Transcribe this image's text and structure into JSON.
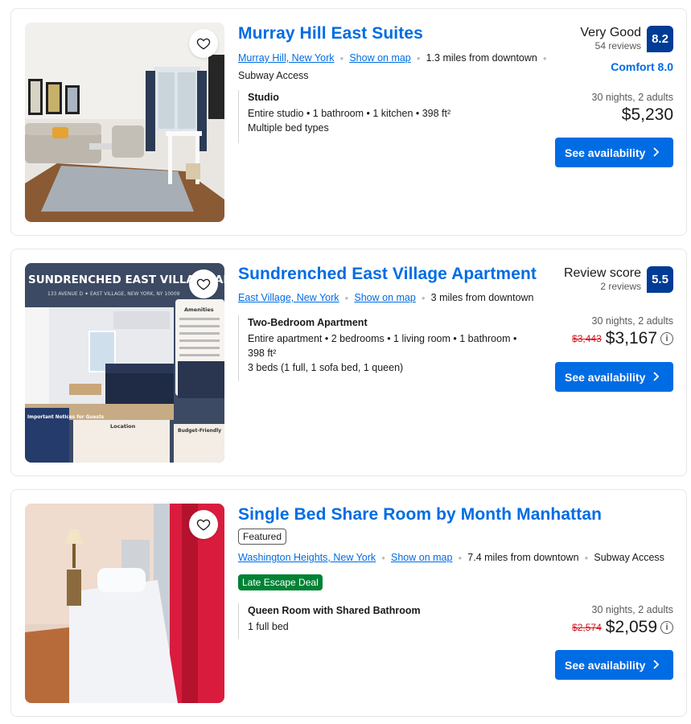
{
  "listings": [
    {
      "title": "Murray Hill East Suites",
      "area": "Murray Hill, New York",
      "map_link": "Show on map",
      "distance": "1.3 miles from downtown",
      "amenity": "Subway Access",
      "rating_word": "Very Good",
      "reviews": "54 reviews",
      "score": "8.2",
      "comfort": "Comfort 8.0",
      "unit_name": "Studio",
      "unit_details": "Entire studio • 1 bathroom • 1 kitchen • 398 ft²",
      "beds": "Multiple bed types",
      "nights": "30 nights, 2 adults",
      "price": "$5,230",
      "cta": "See availability"
    },
    {
      "title": "Sundrenched East Village Apartment",
      "area": "East Village, New York",
      "map_link": "Show on map",
      "distance": "3 miles from downtown",
      "rating_word": "Review score",
      "reviews": "2 reviews",
      "score": "5.5",
      "unit_name": "Two-Bedroom Apartment",
      "unit_details_1": "Entire apartment • 2 bedrooms • 1 living room • 1 bathroom •",
      "unit_details_2": "398 ft²",
      "beds": "3 beds (1 full, 1 sofa bed, 1 queen)",
      "nights": "30 nights, 2 adults",
      "old_price": "$3,443",
      "price": "$3,167",
      "cta": "See availability",
      "photo_text": {
        "headline": "SUNDRENCHED EAST VILLAGE APARTMENT",
        "address": "133 AVENUE D ✦ EAST VILLAGE, NEW YORK, NY 10009",
        "amenities": "Amenities",
        "notices": "Important Notices for Guests",
        "location": "Location",
        "budget": "Budget-Friendly"
      }
    },
    {
      "title": "Single Bed Share Room by Month Manhattan",
      "badge": "Featured",
      "area": "Washington Heights, New York",
      "map_link": "Show on map",
      "distance": "7.4 miles from downtown",
      "amenity": "Subway Access",
      "deal": "Late Escape Deal",
      "unit_name": "Queen Room with Shared Bathroom",
      "beds": "1 full bed",
      "nights": "30 nights, 2 adults",
      "old_price": "$2,574",
      "price": "$2,059",
      "cta": "See availability"
    }
  ],
  "icons": {
    "favorite": "heart-outline-icon",
    "chevron": "chevron-right-icon",
    "info": "info-circle-icon",
    "info_glyph": "i"
  },
  "colors": {
    "link": "#006ce4",
    "score_bg": "#003b95",
    "deal_bg": "#008234",
    "old_price": "#d4111e"
  }
}
